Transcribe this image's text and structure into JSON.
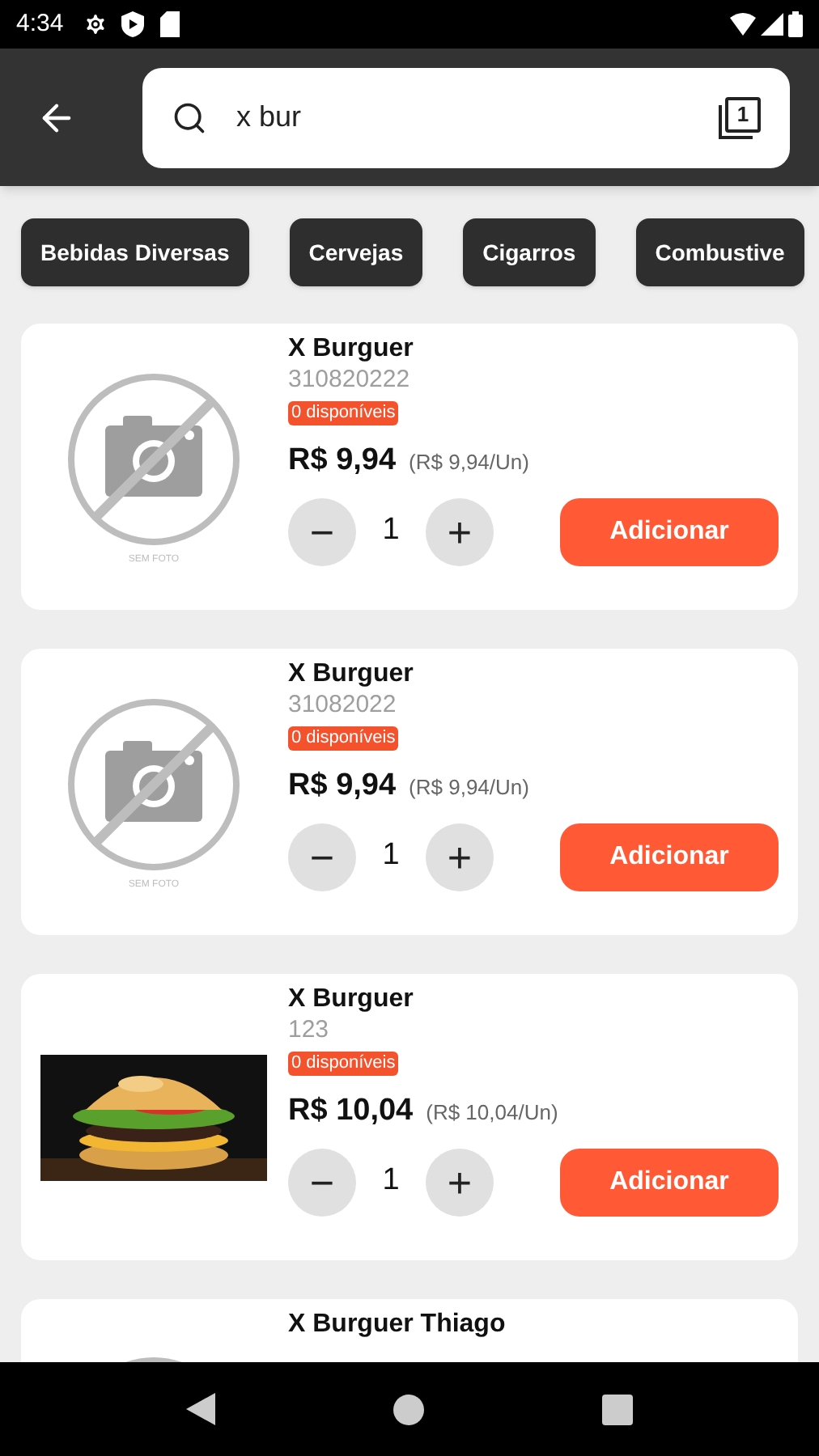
{
  "status_bar": {
    "time": "4:34"
  },
  "search": {
    "value": "x bur",
    "badge": "1"
  },
  "categories": [
    {
      "label": "Bebidas Diversas"
    },
    {
      "label": "Cervejas"
    },
    {
      "label": "Cigarros"
    },
    {
      "label": "Combustive"
    }
  ],
  "products": [
    {
      "kind": "none",
      "no_photo_label": "SEM FOTO",
      "name": "X Burguer",
      "code": "310820222",
      "stock": "0 disponíveis",
      "price": "R$ 9,94",
      "unit_price": "(R$ 9,94/Un)",
      "minus": "−",
      "quantity": "1",
      "plus": "+",
      "button": "Adicionar"
    },
    {
      "kind": "none",
      "no_photo_label": "SEM FOTO",
      "name": "X Burguer",
      "code": "31082022",
      "stock": "0 disponíveis",
      "price": "R$ 9,94",
      "unit_price": "(R$ 9,94/Un)",
      "minus": "−",
      "quantity": "1",
      "plus": "+",
      "button": "Adicionar"
    },
    {
      "kind": "picture",
      "name": "X Burguer",
      "code": "123",
      "stock": "0 disponíveis",
      "price": "R$ 10,04",
      "unit_price": "(R$ 10,04/Un)",
      "minus": "−",
      "quantity": "1",
      "plus": "+",
      "button": "Adicionar"
    },
    {
      "kind": "none",
      "name": "X Burguer Thiago"
    }
  ]
}
